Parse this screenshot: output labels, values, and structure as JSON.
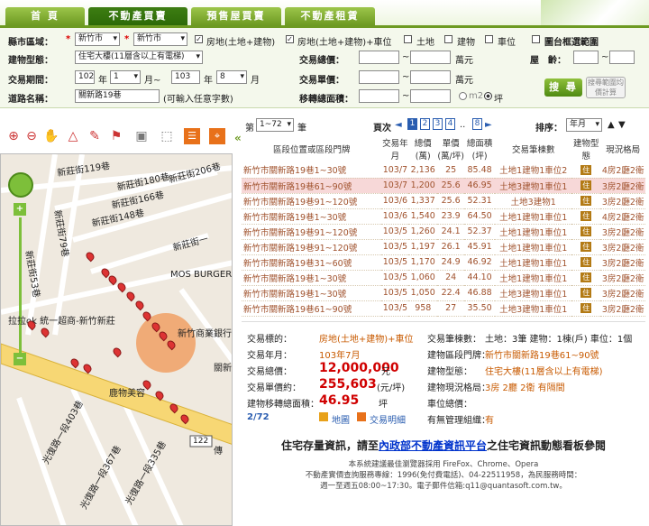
{
  "tabs": [
    "首 頁",
    "不動產買賣",
    "預售屋買賣",
    "不動產租賃"
  ],
  "search": {
    "region_label": "縣市區域：",
    "county": "新竹市",
    "district": "新竹市",
    "opt_land_building": "房地(土地+建物)",
    "opt_land_building_parking": "房地(土地+建物)+車位",
    "opt_land": "土地",
    "opt_building": "建物",
    "opt_parking": "車位",
    "opt_frame": "圖台框選範圍",
    "type_label": "建物型態：",
    "type_value": "住宅大樓(11層含以上有電梯)",
    "total_label": "交易總價：",
    "total_unit": "萬元",
    "age_label": "屋　齡：",
    "period_label": "交易期間：",
    "year_from": "102",
    "m_from": "1",
    "y2": "103",
    "m_to": "8",
    "nian": "年",
    "yue": "月",
    "yue_tilde": "月~",
    "yue2": "月",
    "unit_label": "交易單價：",
    "unit_unit": "萬元",
    "road_label": "道路名稱：",
    "road_value": "關新路19巷",
    "road_hint": "(可輸入任意字數)",
    "area_label": "移轉總面積：",
    "area_m2": "m2",
    "area_ping": "坪",
    "search_btn": "搜 尋",
    "avg_btn": "搜尋範圍均價計算",
    "tilde": "~"
  },
  "map": {
    "labels": [
      "新莊街119巷",
      "新莊街180巷",
      "新莊街206巷",
      "新莊街166巷",
      "新莊街148巷",
      "新莊街79巷",
      "新莊街53巷",
      "新莊街一",
      "MOS BURGER摩斯",
      "拉拉",
      "ok 統一超商-新竹新莊",
      "新竹商業銀行",
      "關新",
      "鹿物美容",
      "光復路一段335巷",
      "光復路一段367巷",
      "光復路一段403巷",
      "傳",
      "122"
    ]
  },
  "pager": {
    "prefix": "第",
    "range": "1~72",
    "suffix": "筆",
    "page_label": "頁次",
    "pages": [
      "1",
      "2",
      "3",
      "4",
      "..",
      "8"
    ],
    "sort_label": "排序：",
    "sort_value": "年月"
  },
  "table": {
    "headers": [
      "區段位置或區段門牌",
      "交易年月",
      "總價(萬)",
      "單價(萬/坪)",
      "總面積(坪)",
      "交易筆棟數",
      "建物型態",
      "現況格局"
    ],
    "rows": [
      [
        "新竹市關新路19巷1~30號",
        "103/7",
        "2,136",
        "25",
        "85.48",
        "土地1建物1車位2",
        "4房2廳2衛"
      ],
      [
        "新竹市關新路19巷61~90號",
        "103/7",
        "1,200",
        "25.6",
        "46.95",
        "土地3建物1車位1",
        "3房2廳2衛"
      ],
      [
        "新竹市關新路19巷91~120號",
        "103/6",
        "1,337",
        "25.6",
        "52.31",
        "土地3建物1",
        "3房2廳2衛"
      ],
      [
        "新竹市關新路19巷1~30號",
        "103/6",
        "1,540",
        "23.9",
        "64.50",
        "土地1建物1車位1",
        "4房2廳2衛"
      ],
      [
        "新竹市關新路19巷91~120號",
        "103/5",
        "1,260",
        "24.1",
        "52.37",
        "土地1建物1車位1",
        "3房2廳2衛"
      ],
      [
        "新竹市關新路19巷91~120號",
        "103/5",
        "1,197",
        "26.1",
        "45.91",
        "土地1建物1車位1",
        "3房2廳2衛"
      ],
      [
        "新竹市關新路19巷31~60號",
        "103/5",
        "1,170",
        "24.9",
        "46.92",
        "土地1建物1車位1",
        "3房2廳2衛"
      ],
      [
        "新竹市關新路19巷1~30號",
        "103/5",
        "1,060",
        "24",
        "44.10",
        "土地1建物1車位1",
        "3房2廳2衛"
      ],
      [
        "新竹市關新路19巷1~30號",
        "103/5",
        "1,050",
        "22.4",
        "46.88",
        "土地3建物1車位1",
        "3房2廳2衛"
      ],
      [
        "新竹市關新路19巷61~90號",
        "103/5",
        "958",
        "27",
        "35.50",
        "土地3建物1車位1",
        "3房2廳2衛"
      ]
    ],
    "badge": "住"
  },
  "detail": {
    "k1": "交易標的：",
    "v1": "房地(土地+建物)+車位",
    "k2": "交易年月：",
    "v2": "103年7月",
    "k3": "交易總價：",
    "v3": "12,000,000",
    "u3": "元",
    "k4": "交易單價約：",
    "v4": "255,603",
    "u4": "(元/坪)",
    "k5": "建物移轉總面積：",
    "v5": "46.95",
    "u5": "坪",
    "count": "2/72",
    "map_link": "地圖",
    "detail_link": "交易明細",
    "r1k": "交易筆棟數：",
    "r1v": "土地：3筆 建物：1棟(戶) 車位：1個",
    "r2k": "建物區段門牌：",
    "r2v": "新竹市關新路19巷61~90號",
    "r3k": "建物型態：",
    "r3v": "住宅大樓(11層含以上有電梯)",
    "r4k": "建物現況格局：",
    "r4v": "3房 2廳 2衛 有隔間",
    "r5k": "車位總價：",
    "r6k": "有無管理組織：",
    "r6v": "有"
  },
  "footer": {
    "pre": "住宅存量資訊，請至",
    "link": "內政部不動產資訊平台",
    "post": "之住宅資訊動態看板參閱",
    "l1": "本系統建議最佳瀏覽器採用 FireFox、Chrome、Opera",
    "l2": "不動產實價查詢服務專線：1996(免付費電話)、04-22511958，為民服務時間：",
    "l3": "週一至週五08:00~17:30。電子郵件信箱:q11@quantasoft.com.tw。"
  }
}
